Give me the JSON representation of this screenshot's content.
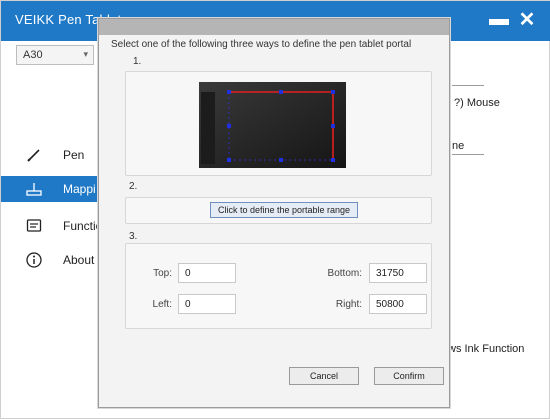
{
  "window": {
    "title": "VEIKK Pen Tablet",
    "minimize_glyph": "▬",
    "close_glyph": "✕"
  },
  "device_select": {
    "value": "A30",
    "caret": "▾"
  },
  "sidebar": {
    "items": [
      {
        "label": "Pen",
        "icon": "pen-icon"
      },
      {
        "label": "Mappi",
        "icon": "mapping-icon"
      },
      {
        "label": "Functio",
        "icon": "function-icon"
      },
      {
        "label": "About",
        "icon": "info-icon"
      }
    ]
  },
  "background": {
    "mouse_label": "?) Mouse",
    "ne_label": "ne",
    "ink_label": "ws Ink Function"
  },
  "dialog": {
    "instruction": "Select one of the following three ways to define the pen tablet portal",
    "step1": "1.",
    "step2": "2.",
    "step3": "3.",
    "define_button": "Click to define the portable range",
    "fields": {
      "top": {
        "label": "Top:",
        "value": "0"
      },
      "bottom": {
        "label": "Bottom:",
        "value": "31750"
      },
      "left": {
        "label": "Left:",
        "value": "0"
      },
      "right": {
        "label": "Right:",
        "value": "50800"
      }
    },
    "cancel": "Cancel",
    "confirm": "Confirm"
  },
  "colors": {
    "accent": "#1f79c6",
    "range_outline": "#e02020",
    "range_handle": "#2030e0"
  }
}
